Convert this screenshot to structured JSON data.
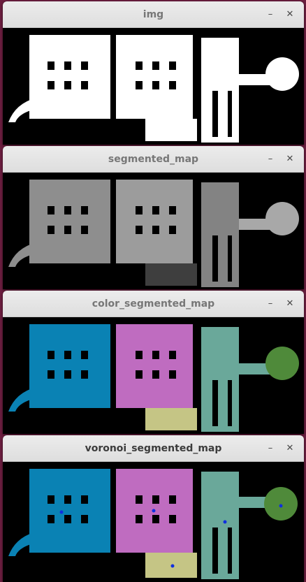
{
  "windows": [
    {
      "title": "img",
      "minimize_icon": "minimize-icon",
      "close_icon": "close-icon"
    },
    {
      "title": "segmented_map",
      "minimize_icon": "minimize-icon",
      "close_icon": "close-icon"
    },
    {
      "title": "color_segmented_map",
      "minimize_icon": "minimize-icon",
      "close_icon": "close-icon"
    },
    {
      "title": "voronoi_segmented_map",
      "minimize_icon": "minimize-icon",
      "close_icon": "close-icon"
    }
  ],
  "buttons": {
    "minimize_label": "–",
    "close_label": "✕"
  },
  "colors": {
    "desktop": "#6b1e3f",
    "canvas_bg": "#000000",
    "binary_region": "#ffffff",
    "gray_region_1": "#8e8e8e",
    "gray_region_2": "#9c9c9c",
    "gray_region_3": "#838383",
    "gray_region_4": "#a8a8a8",
    "gray_region_5": "#3e3e3e",
    "color_region_blue": "#0a82b4",
    "color_region_purple": "#bf6cc0",
    "color_region_teal": "#6aa89a",
    "color_region_green": "#4f8a3a",
    "color_region_olive": "#c5c585",
    "voronoi_marker": "#1030e0"
  }
}
